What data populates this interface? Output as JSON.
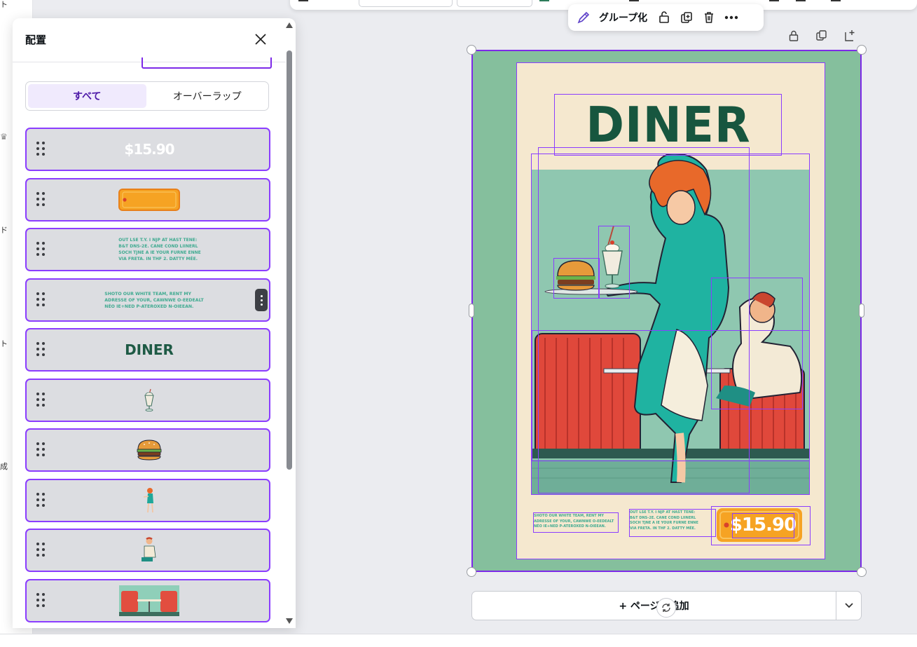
{
  "left_rail": {
    "labels": [
      "ト",
      "ド",
      "ト",
      "成"
    ]
  },
  "context_toolbar": {
    "group_label": "グループ化"
  },
  "position_panel": {
    "title": "配置",
    "tabs": [
      {
        "label": "すべて",
        "active": true
      },
      {
        "label": "オーバーラップ",
        "active": false
      }
    ],
    "layers": [
      {
        "kind": "price-text",
        "label": "$15.90"
      },
      {
        "kind": "price-tag-shape"
      },
      {
        "kind": "body-text",
        "text": "OUT LSE T.Y. I NJP AT HAST TENE:\nB&T DNS-2E. CANE COND LIINERL\nSOCH TJNE A IE YOUR FURNE ENNE\nVIA FRETA. IN THF 2. DATTY MÉE."
      },
      {
        "kind": "body-text",
        "text": "SHOTO OUR WHITE TEAM, RENT MY\nADRESSE OF YOUR, CAWNWE O-EEDEALT\nNÉO IE+NED P-ATEROXED N-OIEEAN.",
        "has_more_menu": true
      },
      {
        "kind": "title-text",
        "label": "DINER"
      },
      {
        "kind": "milkshake-image"
      },
      {
        "kind": "burger-image"
      },
      {
        "kind": "waitress-image"
      },
      {
        "kind": "man-image"
      },
      {
        "kind": "booth-image"
      }
    ]
  },
  "poster": {
    "title": "DINER",
    "price": "$15.90",
    "left_text": "SHOTO OUR WHITE TEAM, RENT MY\nADRESSE OF YOUR, CAWNWE O-EEDEALT\nNÉO IE+NED P-ATEROXED N-OIEEAN.",
    "mid_text": "OUT LSE T.Y. I NJP AT HAST TENE:\nB&T DNS-2E. CANE COND LIINERL\nSOCH TJNE A IE YOUR FURNE ENNE\nVIA FRETA. IN THF 2. DATTY MÉE.",
    "colors": {
      "page_bg": "#85bf9d",
      "poster_bg": "#f5e8cf",
      "title": "#17563f",
      "tag": "#f6a323",
      "selection": "#8b3dff"
    }
  },
  "add_page": {
    "label": "+ ページを追加"
  }
}
